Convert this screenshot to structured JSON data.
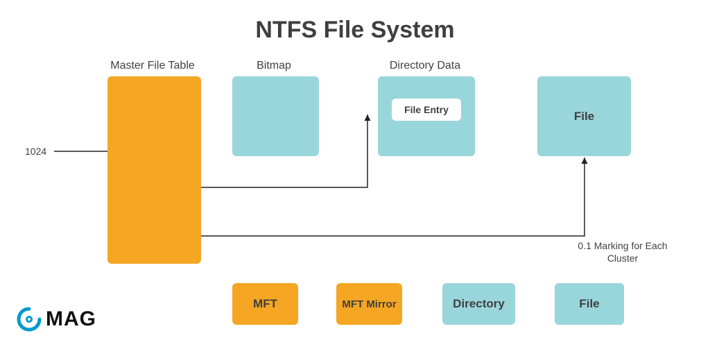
{
  "title": "NTFS File System",
  "labels": {
    "mft": "Master File Table",
    "bitmap": "Bitmap",
    "directory_data": "Directory Data"
  },
  "side_label": "1024",
  "file_entry": "File Entry",
  "file_box": "File",
  "note": "0.1 Marking for Each Cluster",
  "legend": {
    "mft": "MFT",
    "mft_mirror": "MFT Mirror",
    "directory": "Directory",
    "file": "File"
  },
  "logo": {
    "brand": "MAG"
  },
  "colors": {
    "orange": "#f5a623",
    "blue": "#99d6db",
    "accent": "#0099cc"
  }
}
